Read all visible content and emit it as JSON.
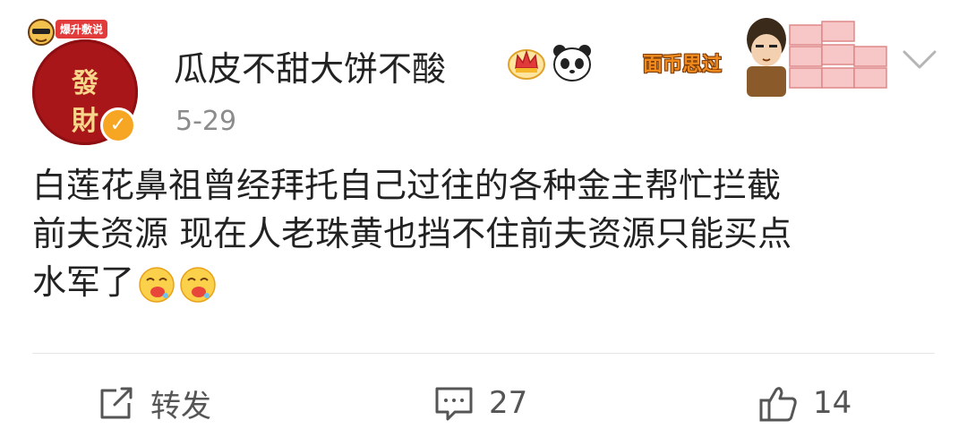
{
  "post": {
    "avatar": {
      "char_top": "發",
      "char_bottom": "財",
      "badge_tag": "爆升敷说"
    },
    "username": "瓜皮不甜大饼不酸",
    "date": "5-29",
    "sticker_text": "面币思过",
    "content_lines": [
      "白莲花鼻祖曾经拜托自己过往的各种金主帮忙拦截",
      "前夫资源 现在人老珠黄也挡不住前夫资源只能买点",
      "水军了"
    ],
    "icons": {
      "verified": "verified-icon",
      "crown": "crown-badge-icon",
      "panda": "panda-icon",
      "chevron": "chevron-down-icon",
      "emoji": "drooling-face-emoji"
    }
  },
  "actions": {
    "repost_label": "转发",
    "comment_count": "27",
    "like_count": "14"
  },
  "colors": {
    "avatar_bg": "#a8161a",
    "verified": "#f6a623",
    "text": "#222222",
    "secondary": "#8c8c8c"
  }
}
